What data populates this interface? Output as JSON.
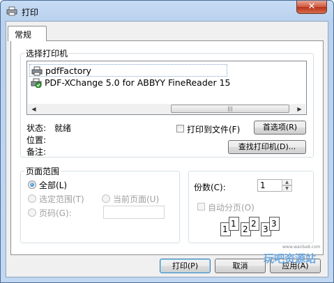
{
  "window": {
    "title": "打印",
    "close_glyph": "✕"
  },
  "tabs": [
    {
      "label": "常规"
    }
  ],
  "select_printer": {
    "group_label": "选择打印机",
    "printers": [
      {
        "name": "pdfFactory",
        "selected": true,
        "icon": "printer-icon"
      },
      {
        "name": "PDF-XChange 5.0 for ABBYY FineReader 15",
        "selected": false,
        "icon": "default-printer-icon"
      }
    ],
    "scroll_left": "◀",
    "scroll_right": "▶",
    "thumb_grip": "|||"
  },
  "status": {
    "status_label": "状态:",
    "status_value": "就绪",
    "location_label": "位置:",
    "comment_label": "备注:"
  },
  "print_to_file": {
    "label": "打印到文件(F)",
    "checked": false
  },
  "preferences_button": "首选项(R)",
  "find_printer_button": "查找打印机(D)...",
  "page_range": {
    "group_label": "页面范围",
    "all": "全部(L)",
    "selection": "选定范围(T)",
    "current_page": "当前页面(U)",
    "pages": "页码(G):",
    "selected_option": "all"
  },
  "copies": {
    "label": "份数(C):",
    "value": "1",
    "collate_label": "自动分页(O)",
    "collate_checked": false,
    "spin_up": "▲",
    "spin_down": "▼",
    "preview_digits": [
      "1",
      "1",
      "2",
      "2",
      "3",
      "3"
    ]
  },
  "buttons": {
    "print": "打印(P)",
    "cancel": "取消",
    "apply": "应用(A)"
  },
  "watermark": {
    "text": "玩吧资源站",
    "small": "www.wanba8.com"
  }
}
